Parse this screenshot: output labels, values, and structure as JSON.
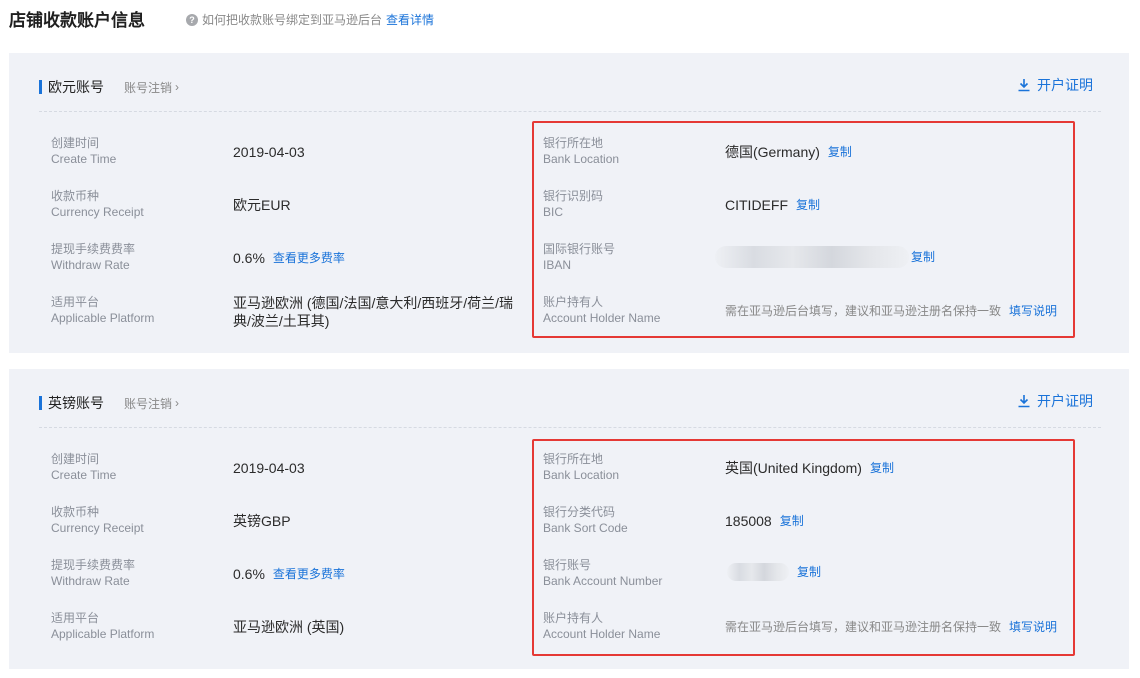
{
  "header": {
    "title": "店铺收款账户信息",
    "help_text": "如何把收款账号绑定到亚马逊后台",
    "help_link": "查看详情"
  },
  "labels": {
    "create_time_cn": "创建时间",
    "create_time_en": "Create Time",
    "currency_cn": "收款币种",
    "currency_en": "Currency Receipt",
    "rate_cn": "提现手续费费率",
    "rate_en": "Withdraw Rate",
    "platform_cn": "适用平台",
    "platform_en": "Applicable Platform",
    "bank_location_cn": "银行所在地",
    "bank_location_en": "Bank Location",
    "holder_cn": "账户持有人",
    "holder_en": "Account Holder Name"
  },
  "common": {
    "cancel_account": "账号注销",
    "certificate": "开户证明",
    "copy": "复制",
    "more_rates": "查看更多费率",
    "holder_note": "需在亚马逊后台填写，建议和亚马逊注册名保持一致",
    "fill_guide": "填写说明"
  },
  "eur": {
    "title": "欧元账号",
    "create_time": "2019-04-03",
    "currency": "欧元EUR",
    "rate": "0.6%",
    "platform": "亚马逊欧洲 (德国/法国/意大利/西班牙/荷兰/瑞典/波兰/土耳其)",
    "bank_location": "德国(Germany)",
    "code_label_cn": "银行识别码",
    "code_label_en": "BIC",
    "code_value": "CITIDEFF",
    "account_label_cn": "国际银行账号",
    "account_label_en": "IBAN"
  },
  "gbp": {
    "title": "英镑账号",
    "create_time": "2019-04-03",
    "currency": "英镑GBP",
    "rate": "0.6%",
    "platform": "亚马逊欧洲 (英国)",
    "bank_location": "英国(United Kingdom)",
    "code_label_cn": "银行分类代码",
    "code_label_en": "Bank Sort Code",
    "code_value": "185008",
    "account_label_cn": "银行账号",
    "account_label_en": "Bank Account Number"
  },
  "colors": {
    "accent": "#1a73d9",
    "highlight": "#e53935",
    "card_bg": "#f0f2f7"
  }
}
